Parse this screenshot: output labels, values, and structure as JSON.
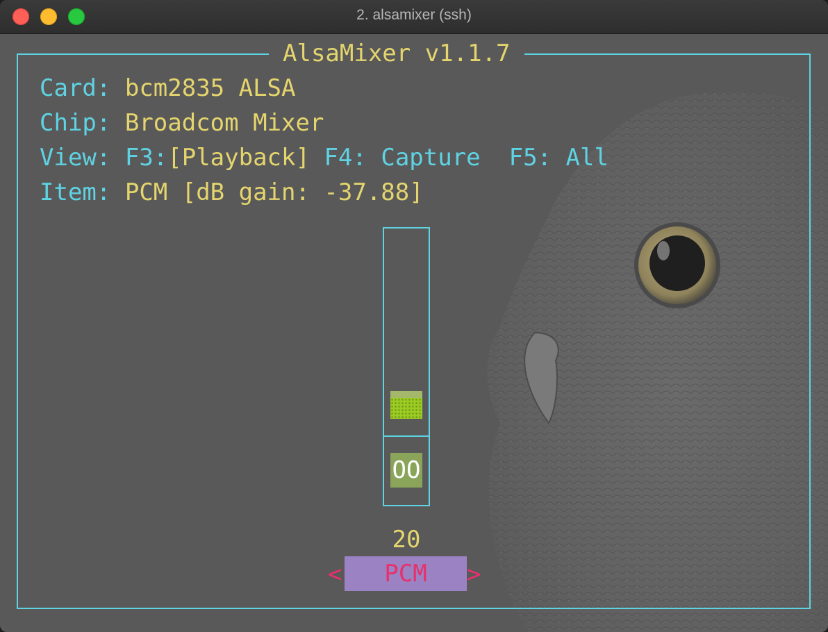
{
  "window": {
    "title": "2. alsamixer (ssh)"
  },
  "mixer": {
    "frame_title": "AlsaMixer v1.1.7",
    "card": {
      "label": "Card:",
      "value": "bcm2835 ALSA"
    },
    "chip": {
      "label": "Chip:",
      "value": "Broadcom Mixer"
    },
    "view": {
      "label": "View:",
      "playback_key": "F3:",
      "playback": "[Playback]",
      "capture_key": "F4:",
      "capture": "Capture",
      "all_key": "F5:",
      "all": "All"
    },
    "item": {
      "label": "Item:",
      "value": "PCM [dB gain: -37.88]"
    },
    "control": {
      "name": "PCM",
      "volume_percent": 20,
      "volume_text": "20",
      "mute_indicator": "OO",
      "left_arrow": "<",
      "right_arrow": ">"
    }
  },
  "colors": {
    "border": "#5fd3e3",
    "label": "#5fd3e3",
    "value": "#e5d56e",
    "slider_fill": "#9ccb24",
    "mute_bg": "#8aa55a",
    "control_bg": "#9b82c3",
    "control_text": "#e8306c",
    "background": "#595959"
  }
}
